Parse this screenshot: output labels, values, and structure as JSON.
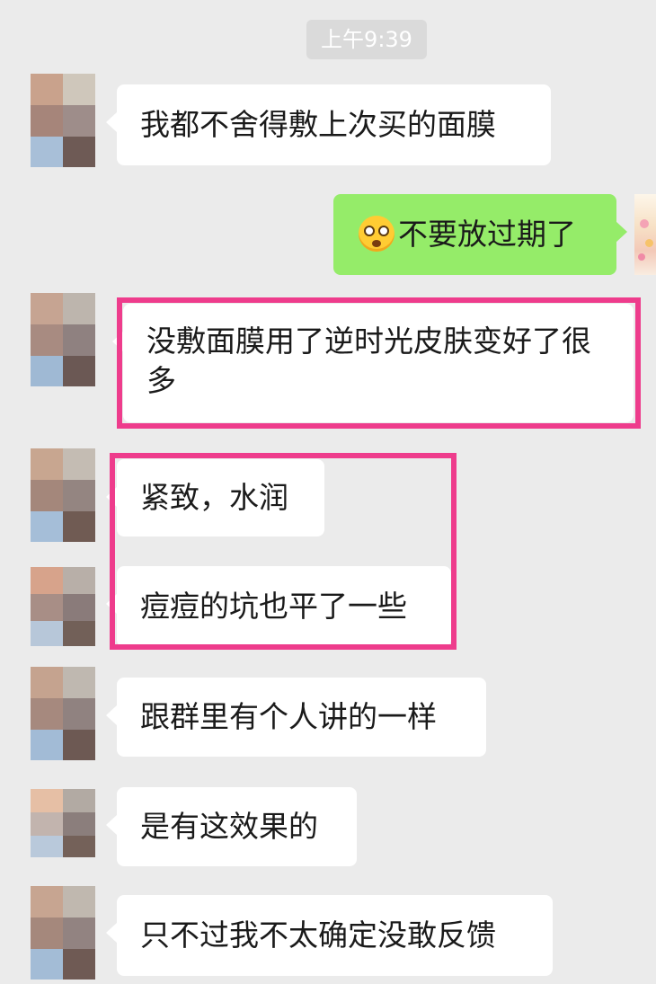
{
  "chat": {
    "timestamp": "上午9:39",
    "messages": [
      {
        "side": "left",
        "text": "我都不舍得敷上次买的面膜"
      },
      {
        "side": "right",
        "emoji": "shocked-face-icon",
        "text": "不要放过期了"
      },
      {
        "side": "left",
        "text_line1": "没敷面膜用了逆时光皮肤变好了很",
        "text_line2": "多",
        "highlighted": true
      },
      {
        "side": "left",
        "text": "紧致，水润",
        "highlighted": true
      },
      {
        "side": "left",
        "text": "痘痘的坑也平了一些",
        "highlighted": true
      },
      {
        "side": "left",
        "text": "跟群里有个人讲的一样"
      },
      {
        "side": "left",
        "text": "是有这效果的"
      },
      {
        "side": "left",
        "text": "只不过我不太确定没敢反馈"
      }
    ]
  },
  "colors": {
    "background": "#ebebeb",
    "incoming_bubble": "#ffffff",
    "outgoing_bubble": "#95ec69",
    "highlight_border": "#ee3c8c",
    "timestamp_badge": "#dadada"
  }
}
